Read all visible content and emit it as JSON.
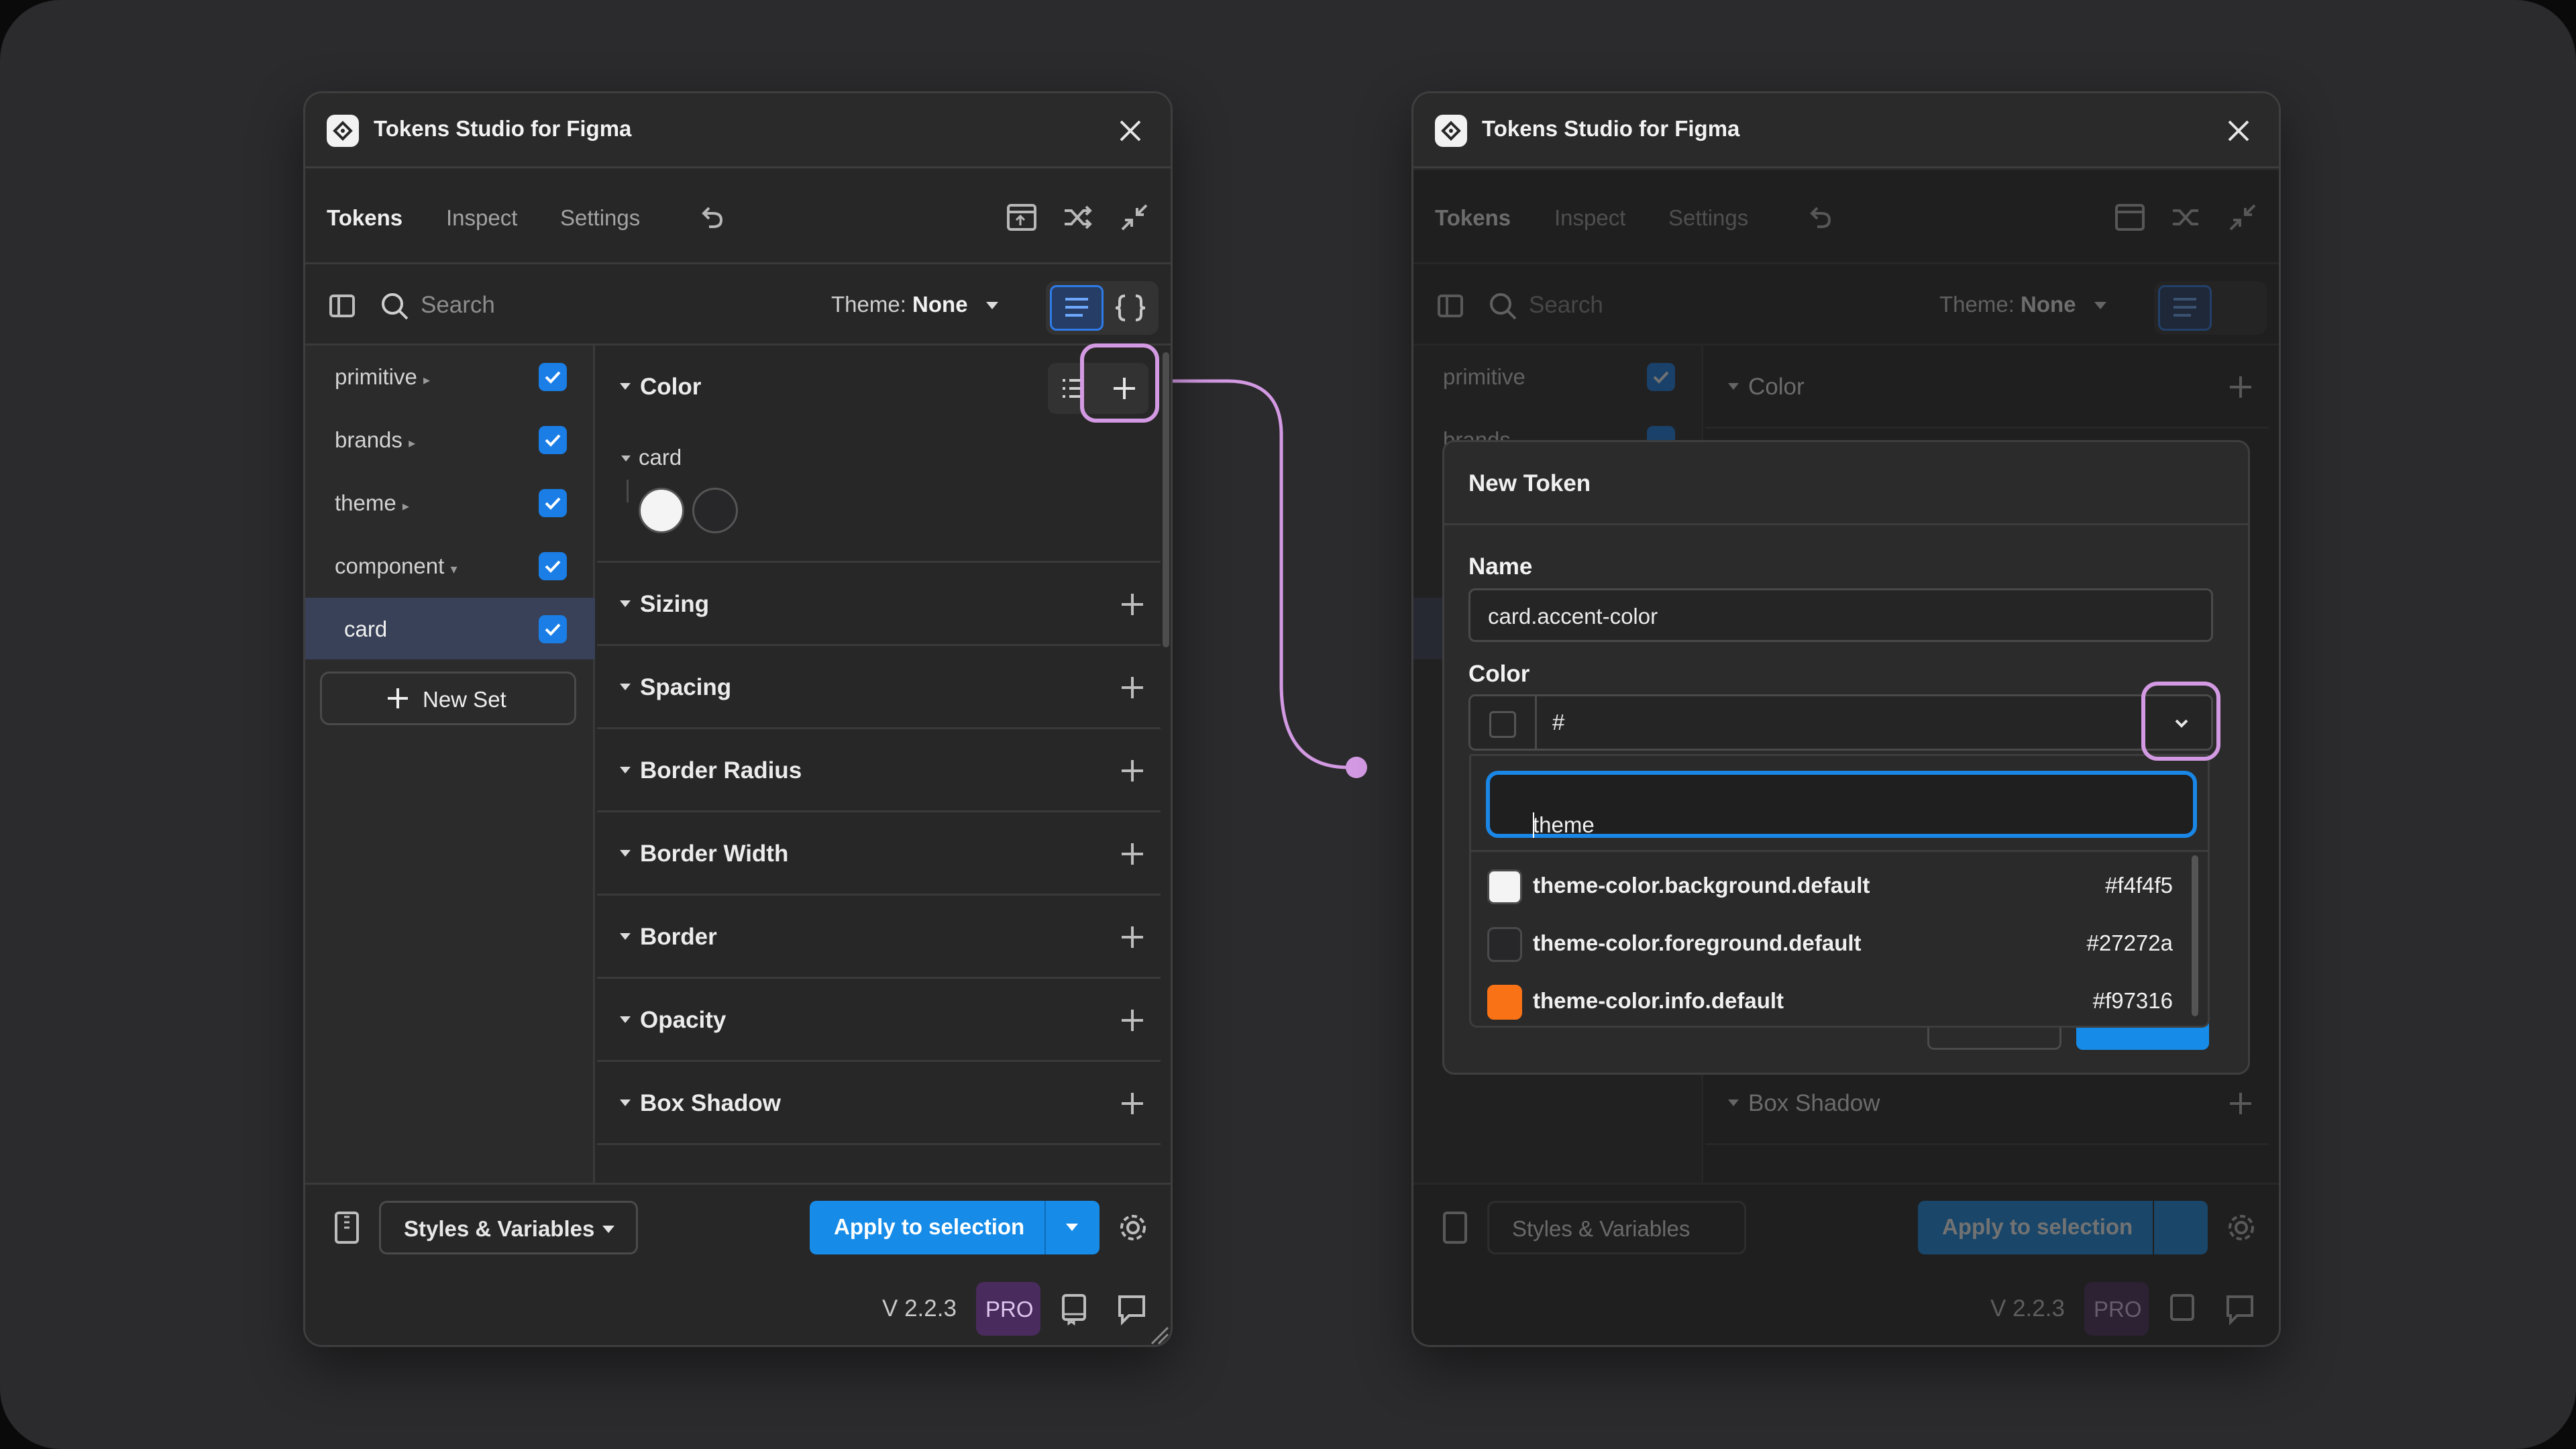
{
  "colors": {
    "accent_blue": "#168ce8",
    "highlight_purple": "#d39ae3",
    "pro_badge_bg": "#4a2b5e",
    "panel_bg": "#272727"
  },
  "panel": {
    "title": "Tokens Studio for Figma",
    "nav": {
      "tabs": [
        "Tokens",
        "Inspect",
        "Settings"
      ],
      "active_tab": "Tokens"
    },
    "search": {
      "placeholder": "Search",
      "theme_prefix": "Theme:",
      "theme_value": "None"
    },
    "sets": [
      {
        "label": "primitive",
        "checked": true
      },
      {
        "label": "brands",
        "checked": true
      },
      {
        "label": "theme",
        "checked": true
      },
      {
        "label": "component",
        "checked": true
      },
      {
        "label": "card",
        "checked": true,
        "selected": true
      }
    ],
    "new_set_label": "New Set",
    "groups": [
      "Color",
      "Sizing",
      "Spacing",
      "Border Radius",
      "Border Width",
      "Border",
      "Opacity",
      "Box Shadow"
    ],
    "color_subgroup": "card",
    "footer": {
      "styles_select": "Styles & Variables",
      "apply_label": "Apply to selection"
    },
    "version": "V 2.2.3",
    "pro_label": "PRO"
  },
  "modal": {
    "title": "New Token",
    "name_label": "Name",
    "name_value": "card.accent-color",
    "color_label": "Color",
    "color_value": "#",
    "filter_value": "theme",
    "options": [
      {
        "name": "theme-color.background.default",
        "value": "#f4f4f5",
        "swatch": "#f4f4f5"
      },
      {
        "name": "theme-color.foreground.default",
        "value": "#27272a",
        "swatch": "#27272a"
      },
      {
        "name": "theme-color.info.default",
        "value": "#f97316",
        "swatch": "#f97316"
      }
    ]
  }
}
